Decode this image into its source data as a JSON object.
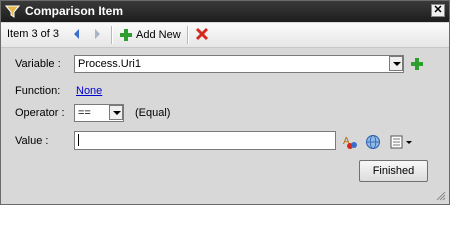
{
  "window": {
    "title": "Comparison Item",
    "close_icon": "close-icon"
  },
  "toolbar": {
    "item_count": "Item 3 of 3",
    "add_new_label": "Add New"
  },
  "form": {
    "variable_label": "Variable :",
    "variable_value": "Process.Uri1",
    "function_label": "Function:",
    "function_value": "None",
    "operator_label": "Operator :",
    "operator_value": "==",
    "operator_desc": "(Equal)",
    "value_label": "Value :",
    "value_value": ""
  },
  "footer": {
    "finished_label": "Finished"
  },
  "colors": {
    "title_bar": "#2a2a2a",
    "link": "#0000cc",
    "add_green": "#2e9e2e",
    "delete_red": "#d42a1e",
    "nav_blue": "#3a6fd0"
  }
}
